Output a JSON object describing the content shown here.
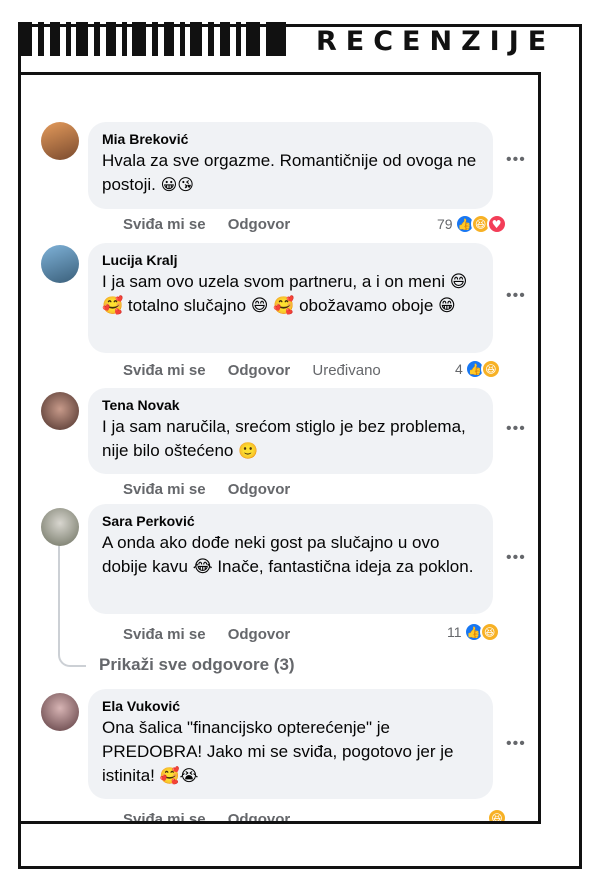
{
  "header": {
    "title": "RECENZIJE"
  },
  "comments": [
    {
      "author": "Mia Breković",
      "text": "Hvala za sve orgazme. Romantičnije od ovoga ne postoji.",
      "emojis": "😀😘",
      "like_label": "Sviđa mi se",
      "reply_label": "Odgovor",
      "reaction_count": "79",
      "reactions": [
        "like-icon",
        "haha-icon",
        "love-icon"
      ],
      "avatar_color": "#b86a3a"
    },
    {
      "author": "Lucija Kralj",
      "text": "I ja sam ovo uzela svom partneru, a i on meni 😄 🥰 totalno slučajno 😄 🥰 obožavamo oboje 😁",
      "like_label": "Sviđa mi se",
      "reply_label": "Odgovor",
      "edited_label": "Uređivano",
      "reaction_count": "4",
      "reactions": [
        "like-icon",
        "haha-icon"
      ],
      "avatar_color": "#5a8fb8"
    },
    {
      "author": "Tena Novak",
      "text": "I ja sam naručila, srećom stiglo je bez problema, nije bilo oštećeno",
      "emojis": "🙂",
      "like_label": "Sviđa mi se",
      "reply_label": "Odgovor",
      "avatar_color": "#6b4a3f"
    },
    {
      "author": "Sara Perković",
      "text": "A onda ako dođe neki gost pa slučajno u ovo dobije kavu 😂 Inače, fantastična ideja za poklon.",
      "like_label": "Sviđa mi se",
      "reply_label": "Odgovor",
      "reaction_count": "11",
      "reactions": [
        "like-icon",
        "haha-icon"
      ],
      "avatar_color": "#8a8f7a"
    },
    {
      "author": "Ela Vuković",
      "text": "Ona šalica \"financijsko opterećenje\" je PREDOBRA! Jako mi se sviđa, pogotovo jer je istinita!",
      "emojis": "🥰😭",
      "like_label": "Sviđa mi se",
      "reply_label": "Odgovor",
      "reactions": [
        "haha-icon"
      ],
      "avatar_color": "#8a5a63"
    }
  ],
  "show_replies": "Prikaži sve odgovore (3)",
  "more_icon": "ellipsis-icon"
}
